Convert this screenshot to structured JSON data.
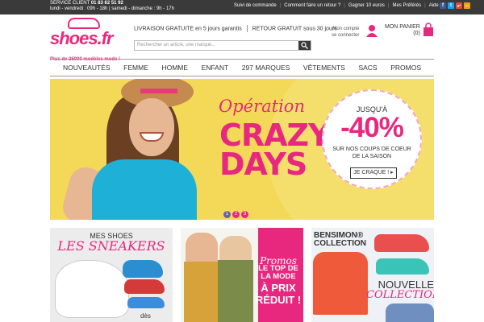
{
  "topbar": {
    "service_label": "SERVICE CLIENT",
    "phone": "01 83 62 51 92",
    "hours": "lundi - vendredi : 09h - 18h | samedi - dimanche : 9h - 17h",
    "links": [
      "Suivi de commande",
      "Comment faire un retour ?",
      "Gagner 10 euros",
      "Mes Préférés",
      "Aide"
    ],
    "social": [
      "f",
      "t",
      "g+",
      "rss"
    ]
  },
  "header": {
    "logo_text": "shoes.fr",
    "tagline": "Plus de 25000 modèles mode !",
    "free_delivery": "LIVRAISON GRATUITE",
    "free_delivery_detail": "en 5 jours garantis",
    "free_return": "RETOUR GRATUIT",
    "free_return_detail": "sous 30 jours",
    "search_placeholder": "Rechercher un article, une marque...",
    "account_line1": "Mon compte",
    "account_line2": "se connecter",
    "cart_label": "MON PANIER",
    "cart_count": "(0)"
  },
  "nav": [
    "NOUVEAUTÉS",
    "FEMME",
    "HOMME",
    "ENFANT",
    "297 MARQUES",
    "VÊTEMENTS",
    "SACS",
    "PROMOS"
  ],
  "banner": {
    "operation": "Opération",
    "crazy": "CRAZY",
    "days": "DAYS",
    "upto": "JUSQU'À",
    "percent": "-40%",
    "sub1": "SUR NOS COUPS DE COEUR",
    "sub2": "DE LA SAISON",
    "cta": "JE CRAQUE ! ▸",
    "dots": [
      "1",
      "2",
      "3"
    ]
  },
  "tiles": {
    "t1_line1": "MES SHOES",
    "t1_line2": "LES SNEAKERS",
    "t1_price": "dès",
    "t2_l1": "Promos",
    "t2_l2": "LE TOP DE",
    "t2_l3": "LA MODE",
    "t2_l4": "À PRIX",
    "t2_l5": "RÉDUIT !",
    "t3_brand1": "BENSIMON®",
    "t3_brand2": "COLLECTION",
    "t3_nv1": "NOUVELLE",
    "t3_nv2": "COLLECTION"
  },
  "colors": {
    "accent": "#e8287f",
    "topbar": "#3a3a3a",
    "banner": "#f3d957"
  }
}
